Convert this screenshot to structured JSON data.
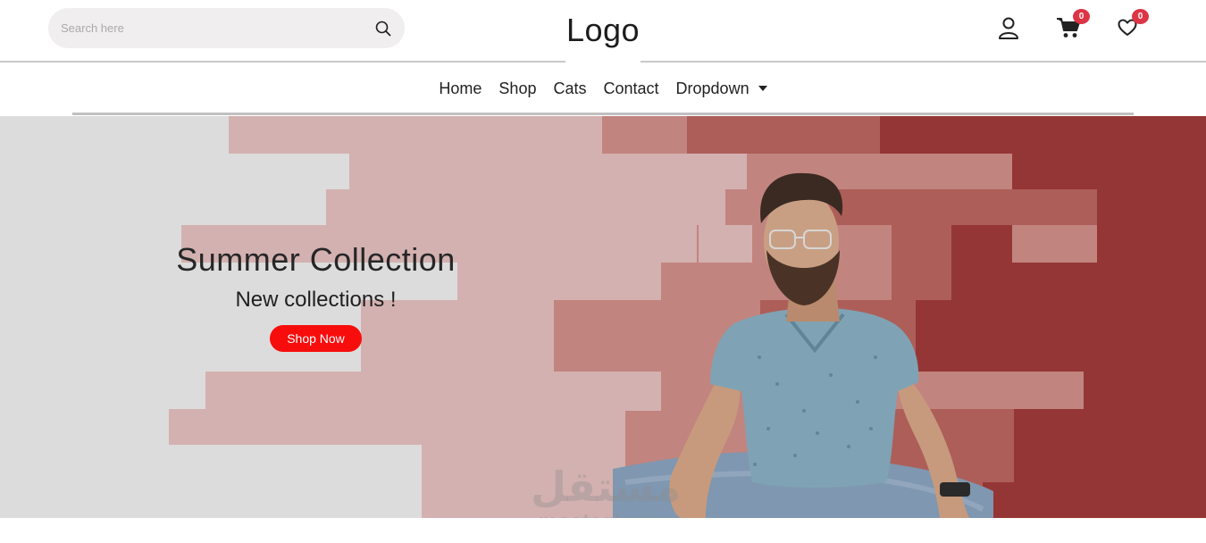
{
  "header": {
    "search": {
      "placeholder": "Search here",
      "value": "",
      "icon": "search-icon"
    },
    "logo": "Logo",
    "icons": {
      "account": {
        "icon": "user-icon"
      },
      "cart": {
        "icon": "cart-icon",
        "count": "0"
      },
      "wishlist": {
        "icon": "heart-icon",
        "count": "0"
      }
    },
    "badge_color": "#dc3545"
  },
  "nav": {
    "items": [
      {
        "label": "Home"
      },
      {
        "label": "Shop"
      },
      {
        "label": "Cats"
      },
      {
        "label": "Contact"
      },
      {
        "label": "Dropdown"
      }
    ]
  },
  "hero": {
    "title": "Summer Collection",
    "subtitle": "New collections !",
    "cta": "Shop Now",
    "cta_color": "#f80d0d",
    "palette": [
      "#dcdcdc",
      "#d3b1b0",
      "#c2847f",
      "#ad5e59",
      "#953636"
    ]
  },
  "watermark": {
    "arabic": "مستقل",
    "latin": "mostaql.com"
  }
}
